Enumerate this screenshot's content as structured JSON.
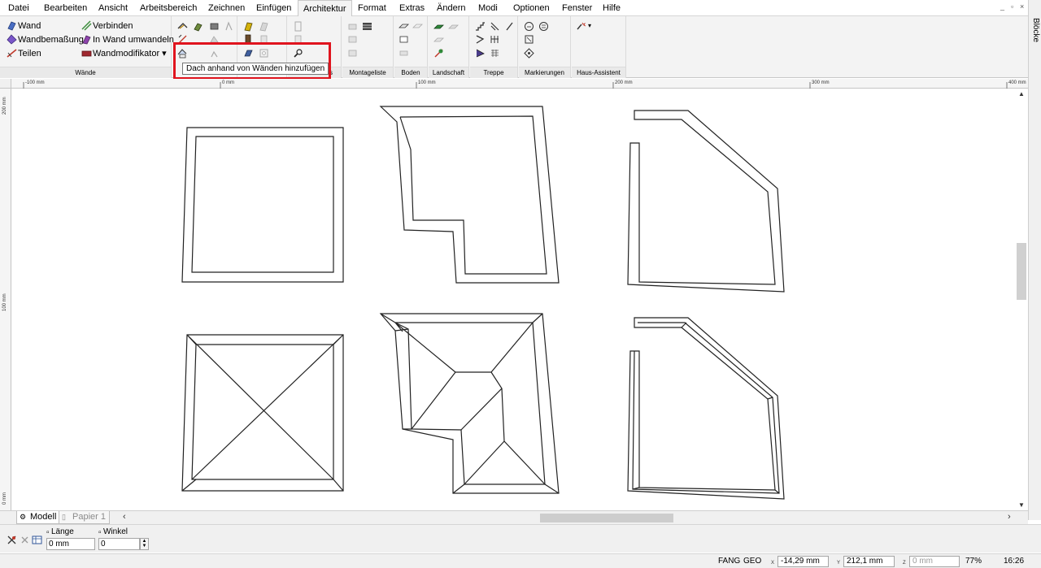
{
  "menubar": {
    "items": [
      "Datei",
      "Bearbeiten",
      "Ansicht",
      "Arbeitsbereich",
      "Zeichnen",
      "Einfügen",
      "Architektur",
      "Format",
      "Extras",
      "Ändern",
      "Modi",
      "Optionen",
      "Fenster",
      "Hilfe"
    ],
    "active": "Architektur"
  },
  "ribbon": {
    "waende": {
      "wand": "Wand",
      "wandbemassung": "Wandbemaßung",
      "teilen": "Teilen",
      "verbinden": "Verbinden",
      "in_wand_umwandeln": "In Wand umwandeln",
      "wandmodifikator": "Wandmodifikator ▾",
      "label": "Wände"
    },
    "dach_label_tail": "s",
    "montageliste": "Montageliste",
    "boden": "Boden",
    "landschaft": "Landschaft",
    "treppe": "Treppe",
    "markierungen": "Markierungen",
    "haus_assistent": "Haus-Assistent"
  },
  "tooltip": "Dach anhand von Wänden hinzufügen",
  "ruler": {
    "h_labels": [
      "-100 mm",
      "0 mm",
      "100 mm",
      "200 mm",
      "300 mm",
      "400 mm"
    ],
    "v_labels": [
      "200 mm",
      "100 mm",
      "0 mm"
    ]
  },
  "right_panel": {
    "title": "Blöcke"
  },
  "tabs": {
    "modell": "Modell",
    "papier": "Papier 1"
  },
  "command": {
    "laenge_label": "Länge",
    "laenge_value": "0 mm",
    "winkel_label": "Winkel",
    "winkel_value": "0"
  },
  "status": {
    "fang": "FANG",
    "geo": "GEO",
    "x": "-14,29 mm",
    "y": "212,1 mm",
    "z": "0 mm",
    "zoom": "77%",
    "time": "16:26",
    "x_axis": "X",
    "y_axis": "Y",
    "z_axis": "Z"
  }
}
